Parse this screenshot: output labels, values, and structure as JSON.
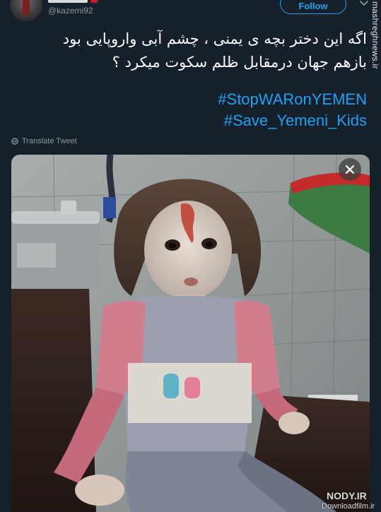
{
  "tweet": {
    "handle": "@kazemi92",
    "follow_label": "Follow",
    "text_lines": [
      "اگه این دختر بچه ی یمنی ، چشم آبی وارو‌پایی بود",
      "بازهم جهان درمقابل  ظلم سکوت میکرد ؟"
    ],
    "hashtags": [
      "#StopWARonYEMEN",
      "#Save_Yemeni_Kids"
    ],
    "translate_label": "Translate Tweet"
  },
  "icons": {
    "chevron": "chevron-down-icon",
    "globe": "globe-icon",
    "close": "close-icon"
  },
  "watermarks": {
    "side": "mashreghnews.ir",
    "bottom_brand": "NODY.IR",
    "bottom_sub": "Downloadfilm.ir"
  },
  "colors": {
    "background": "#15202b",
    "accent": "#1da1f2",
    "text": "#ffffff",
    "muted": "#8899a6"
  }
}
